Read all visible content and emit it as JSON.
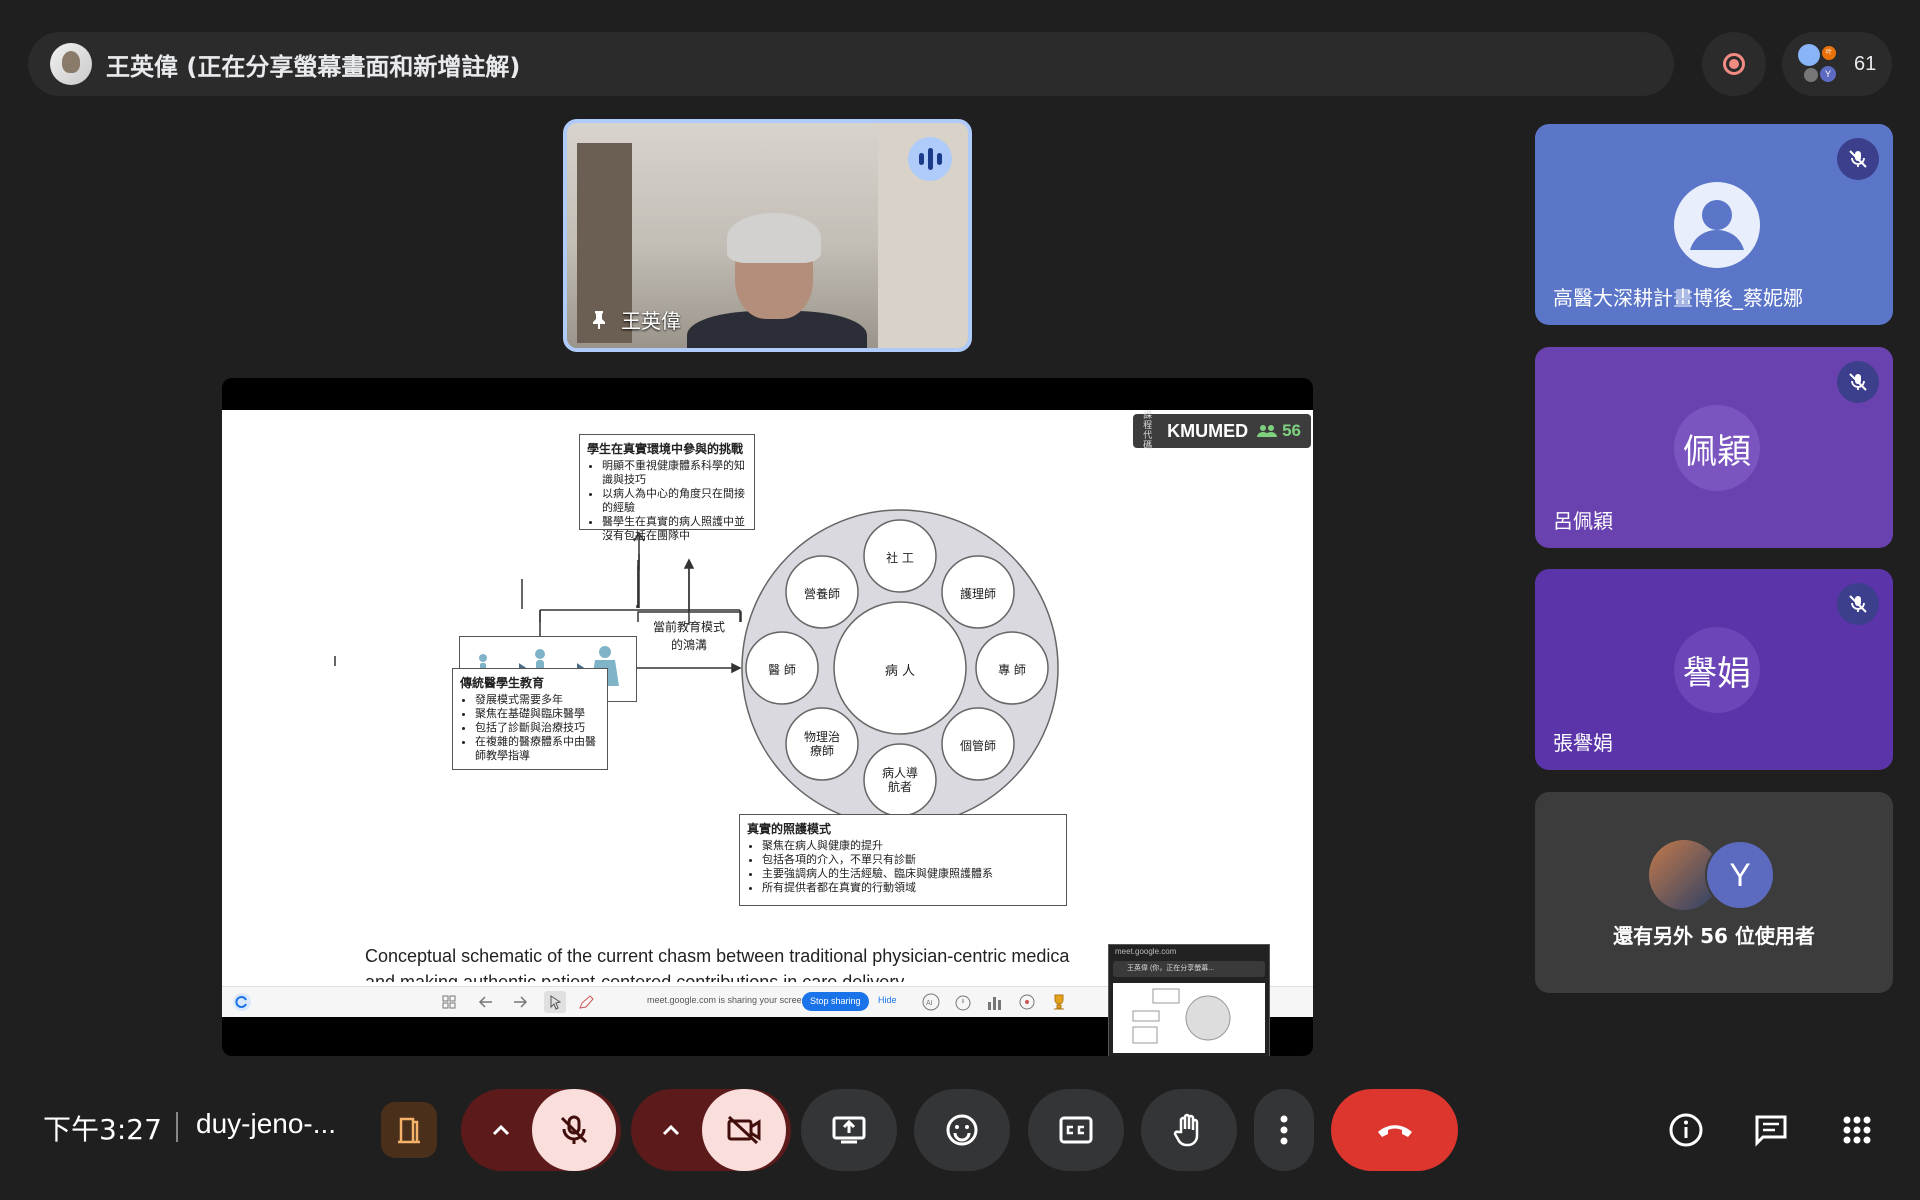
{
  "presenter_bar": {
    "title": "王英偉 (正在分享螢幕畫面和新增註解)"
  },
  "people": {
    "count": "61"
  },
  "self_tile": {
    "name": "王英偉"
  },
  "presentation": {
    "class_badge_small": "課程代碼",
    "class_name": "KMUMED",
    "class_count": "56",
    "box_top": {
      "title": "學生在真實環境中參與的挑戰",
      "items": [
        "明顯不重視健康體系科學的知識與技巧",
        "以病人為中心的角度只在間接的經驗",
        "醫學生在真實的病人照護中並沒有包括在團隊中"
      ]
    },
    "gap_label": "當前教育模式的鴻溝",
    "box_left": {
      "title": "傳統醫學生教育",
      "items": [
        "發展模式需要多年",
        "聚焦在基礎與臨床醫學",
        "包括了診斷與治療技巧",
        "在複雜的醫療體系中由醫師教學指導"
      ]
    },
    "box_bottom": {
      "title": "真實的照護模式",
      "items": [
        "聚焦在病人與健康的提升",
        "包括各項的介入，不單只有診斷",
        "主要強調病人的生活經驗、臨床與健康照護體系",
        "所有提供者都在真實的行動領域"
      ]
    },
    "circle": {
      "center": "病 人",
      "roles": [
        "社 工",
        "護理師",
        "專 師",
        "個管師",
        "病人導航者",
        "物理治療師",
        "醫 師",
        "營養師"
      ]
    },
    "caption_line1": "Conceptual schematic of the current chasm between traditional physician-centric medica",
    "caption_line2": "and making authentic patient-centered contributions in care delivery",
    "toolbar": {
      "sharing_text": "meet.google.com is sharing your screen.",
      "stop_label": "Stop sharing",
      "hide_label": "Hide"
    },
    "mini_preview": {
      "url": "meet.google.com",
      "bar_text": "王英偉 (你，正在分享螢幕..."
    }
  },
  "tiles": [
    {
      "name": "高醫大深耕計畫博後_蔡妮娜",
      "avatar": "",
      "color": "#5b76c9"
    },
    {
      "name": "呂佩穎",
      "avatar": "佩穎",
      "color": "#6a42b0"
    },
    {
      "name": "張譽娟",
      "avatar": "譽娟",
      "color": "#5a34a8"
    }
  ],
  "others": {
    "avatar2": "Y",
    "text": "還有另外 56 位使用者"
  },
  "bottom_bar": {
    "time": "下午3:27",
    "meeting_code": "duy-jeno-..."
  }
}
